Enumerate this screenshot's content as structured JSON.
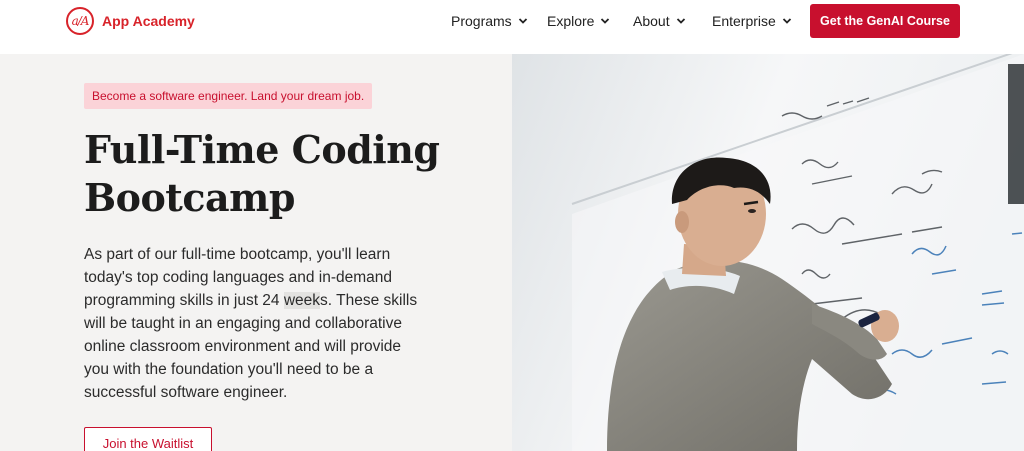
{
  "brand": {
    "name": "App Academy",
    "mark": "a/A",
    "color": "#d8232a"
  },
  "nav": {
    "items": [
      {
        "label": "Programs"
      },
      {
        "label": "Explore"
      },
      {
        "label": "About"
      },
      {
        "label": "Enterprise"
      }
    ],
    "cta_label": "Get the GenAI Course"
  },
  "hero": {
    "tagline": "Become a software engineer. Land your dream job.",
    "title_line1": "Full-Time Coding",
    "title_line2": "Bootcamp",
    "desc_part1": "As part of our full-time bootcamp, you'll learn today's top coding languages and in-demand programming skills in just 24 ",
    "desc_highlight": "week",
    "desc_part2": "s. These skills will be taught in an engaging and collaborative online classroom environment and will provide you with the foundation you'll need to be a successful software engineer.",
    "waitlist_label": "Join the Waitlist",
    "photo_alt": ""
  },
  "colors": {
    "accent": "#c8102e",
    "tag_bg": "#fbd3d8",
    "hero_bg": "#f4f3f2"
  }
}
